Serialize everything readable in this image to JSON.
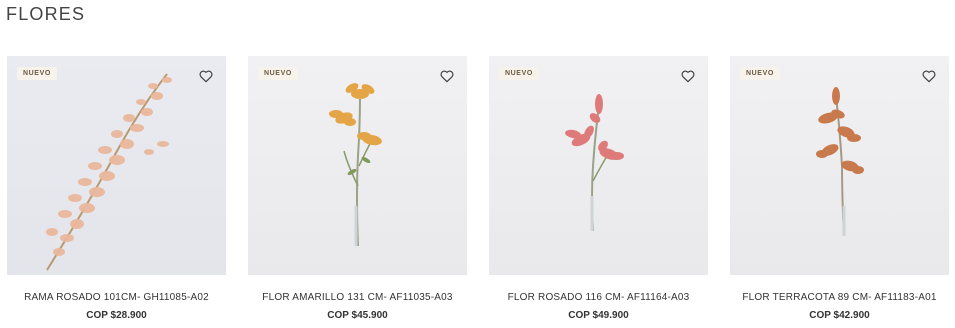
{
  "section": {
    "title": "FLORES"
  },
  "products": [
    {
      "badge": "NUEVO",
      "name": "RAMA ROSADO 101CM- GH11085-A02",
      "price": "COP $28.900",
      "icon": "heart-icon",
      "color": "#e8b79a"
    },
    {
      "badge": "NUEVO",
      "name": "FLOR AMARILLO 131 CM- AF11035-A03",
      "price": "COP $45.900",
      "icon": "heart-icon",
      "color": "#e3a24a"
    },
    {
      "badge": "NUEVO",
      "name": "FLOR ROSADO 116 CM- AF11164-A03",
      "price": "COP $49.900",
      "icon": "heart-icon",
      "color": "#e07a7a"
    },
    {
      "badge": "NUEVO",
      "name": "FLOR TERRACOTA 89 CM- AF11183-A01",
      "price": "COP $42.900",
      "icon": "heart-icon",
      "color": "#c97a4c"
    }
  ]
}
